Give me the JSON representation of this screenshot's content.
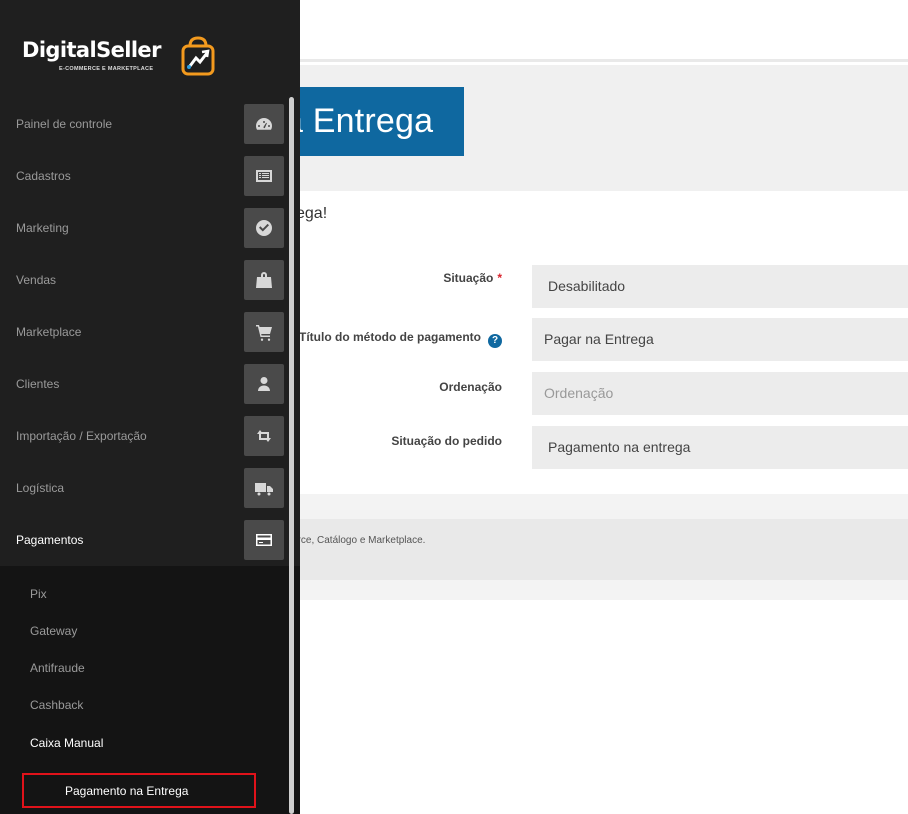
{
  "page": {
    "title": "Pagar na Entrega",
    "title_visible": "a Entrega",
    "intro_visible": "ega!",
    "accent": "#0f68a0"
  },
  "form": {
    "situacao": {
      "label": "Situação",
      "required_mark": "*",
      "value": "Desabilitado"
    },
    "titulo": {
      "label": "Título do método de pagamento",
      "help": "?",
      "value": "Pagar na Entrega"
    },
    "ordenacao": {
      "label": "Ordenação",
      "placeholder": "Ordenação"
    },
    "situacao_pedido": {
      "label": "Situação do pedido",
      "value": "Pagamento na entrega"
    }
  },
  "footer": {
    "text": "erce, Catálogo e Marketplace."
  },
  "logo": {
    "name": "DigitalSeller",
    "tagline": "E-COMMERCE E MARKETPLACE"
  },
  "sidebar": {
    "items": [
      {
        "label": "Painel de controle",
        "icon": "dashboard-icon"
      },
      {
        "label": "Cadastros",
        "icon": "list-icon"
      },
      {
        "label": "Marketing",
        "icon": "check-circle-icon"
      },
      {
        "label": "Vendas",
        "icon": "shopping-bag-icon"
      },
      {
        "label": "Marketplace",
        "icon": "cart-icon"
      },
      {
        "label": "Clientes",
        "icon": "user-icon"
      },
      {
        "label": "Importação / Exportação",
        "icon": "exchange-icon"
      },
      {
        "label": "Logística",
        "icon": "truck-icon"
      },
      {
        "label": "Pagamentos",
        "icon": "credit-card-icon"
      }
    ],
    "submenu": [
      {
        "label": "Pix"
      },
      {
        "label": "Gateway"
      },
      {
        "label": "Antifraude"
      },
      {
        "label": "Cashback"
      },
      {
        "label": "Caixa Manual"
      }
    ],
    "active_subitem": "Pagamento na Entrega"
  }
}
